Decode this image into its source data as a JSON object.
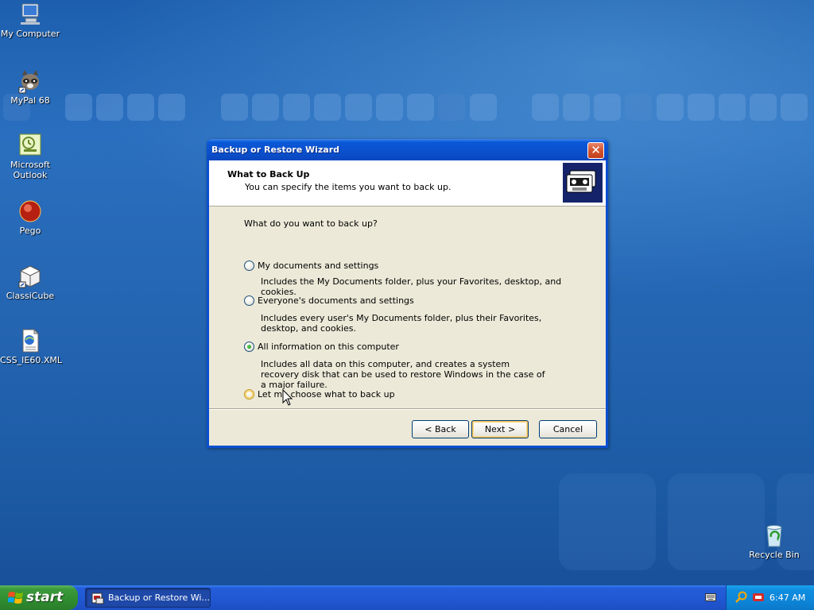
{
  "desktop": {
    "icons": [
      {
        "label": "My Computer"
      },
      {
        "label": "MyPal 68"
      },
      {
        "label": "Microsoft Outlook"
      },
      {
        "label": "Pego"
      },
      {
        "label": "ClassiCube"
      },
      {
        "label": "CSS_IE60.XML"
      },
      {
        "label": "Recycle Bin"
      }
    ]
  },
  "dialog": {
    "title": "Backup or Restore Wizard",
    "close_label": "✕",
    "header_title": "What to Back Up",
    "header_subtitle": "You can specify the items you want to back up.",
    "question": "What do you want to back up?",
    "options": [
      {
        "label": "My documents and settings",
        "description": "Includes the My Documents folder, plus your Favorites, desktop, and cookies.",
        "selected": false
      },
      {
        "label": "Everyone's documents and settings",
        "description": "Includes every user's My Documents folder, plus their Favorites, desktop, and cookies.",
        "selected": false
      },
      {
        "label": "All information on this computer",
        "description": "Includes all data on this computer, and creates a system recovery disk that can be used to restore Windows in the case of a major failure.",
        "selected": true
      },
      {
        "label": "Let me choose what to back up",
        "description": "",
        "selected": false
      }
    ],
    "buttons": {
      "back": "< Back",
      "next": "Next >",
      "cancel": "Cancel"
    }
  },
  "taskbar": {
    "start_label": "start",
    "task_item": "Backup or Restore Wi...",
    "clock": "6:47 AM"
  }
}
